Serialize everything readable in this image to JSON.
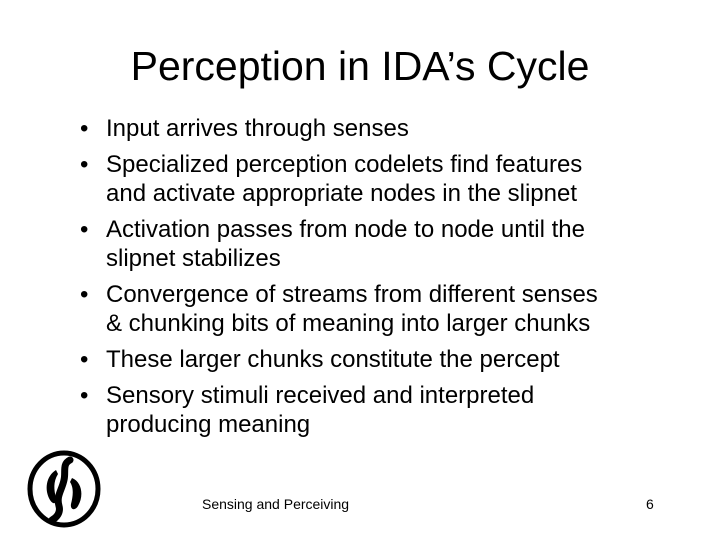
{
  "slide": {
    "title": "Perception in IDA’s Cycle",
    "bullet_glyph": "•",
    "bullets": [
      {
        "lines": [
          "Input arrives through senses"
        ]
      },
      {
        "lines": [
          "Specialized perception codelets find features",
          "and activate appropriate nodes in the slipnet"
        ]
      },
      {
        "lines": [
          "Activation passes from node to node until the",
          "slipnet stabilizes"
        ]
      },
      {
        "lines": [
          "Convergence of streams from different senses",
          "& chunking bits of meaning into larger chunks"
        ]
      },
      {
        "lines": [
          "These larger chunks constitute the percept"
        ]
      },
      {
        "lines": [
          "Sensory stimuli received and interpreted",
          "producing meaning"
        ]
      }
    ]
  },
  "footer": {
    "text": "Sensing and Perceiving",
    "page_number": "6"
  },
  "logo": {
    "icon": "stylized-swirl-logo-icon",
    "color": "#000000"
  }
}
